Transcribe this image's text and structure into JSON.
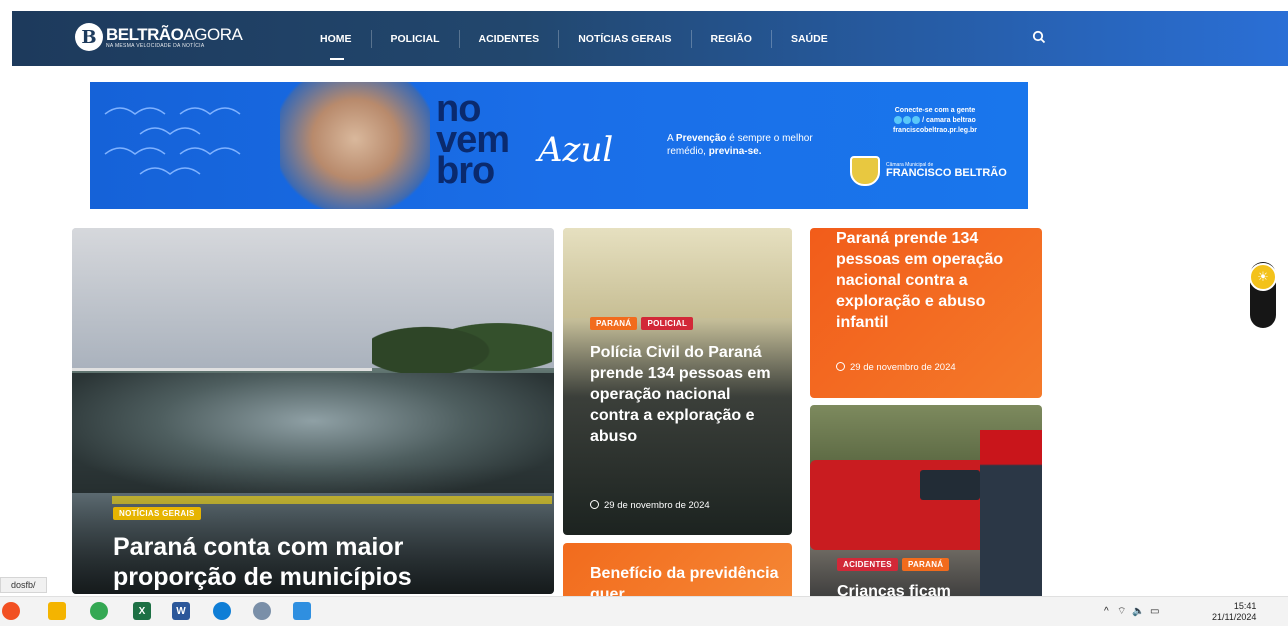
{
  "header": {
    "logo_bold": "BELTRÃO",
    "logo_light": "AGORA",
    "logo_tagline": "NA MESMA VELOCIDADE DA NOTÍCIA",
    "nav": [
      "HOME",
      "POLICIAL",
      "ACIDENTES",
      "NOTÍCIAS GERAIS",
      "REGIÃO",
      "SAÚDE"
    ],
    "active_nav": "HOME",
    "search_icon": "search-icon"
  },
  "banner": {
    "novem_1": "no",
    "novem_2": "vem",
    "novem_3": "bro",
    "azul": "Azul",
    "prevention_pre": "A",
    "prevention_bold": "Prevenção",
    "prevention_mid": "é sempre o melhor remédio,",
    "prevention_end": "previna-se.",
    "connect": "Conecte-se com a gente",
    "handle": "/ camara beltrao",
    "site": "franciscobeltrao.pr.leg.br",
    "camara_small": "Câmara Municipal de",
    "camara_big": "FRANCISCO BELTRÃO"
  },
  "cards": {
    "main": {
      "tag": "NOTÍCIAS GERAIS",
      "title": "Paraná conta com maior proporção de municípios"
    },
    "mid": {
      "tags": [
        "PARANÁ",
        "POLICIAL"
      ],
      "title": "Polícia Civil do Paraná prende 134 pessoas em operação nacional contra a exploração e abuso",
      "date": "29 de novembro de 2024"
    },
    "mid2": {
      "title": "Benefício da previdência quer"
    },
    "right1": {
      "title": "Paraná prende 134 pessoas em operação nacional contra a exploração e abuso infantil",
      "date": "29 de novembro de 2024"
    },
    "right2": {
      "tags": [
        "ACIDENTES",
        "PARANÁ"
      ],
      "title": "Crianças ficam"
    }
  },
  "status_url": "dosfb/",
  "taskbar": {
    "time": "15:41",
    "date": "21/11/2024"
  }
}
